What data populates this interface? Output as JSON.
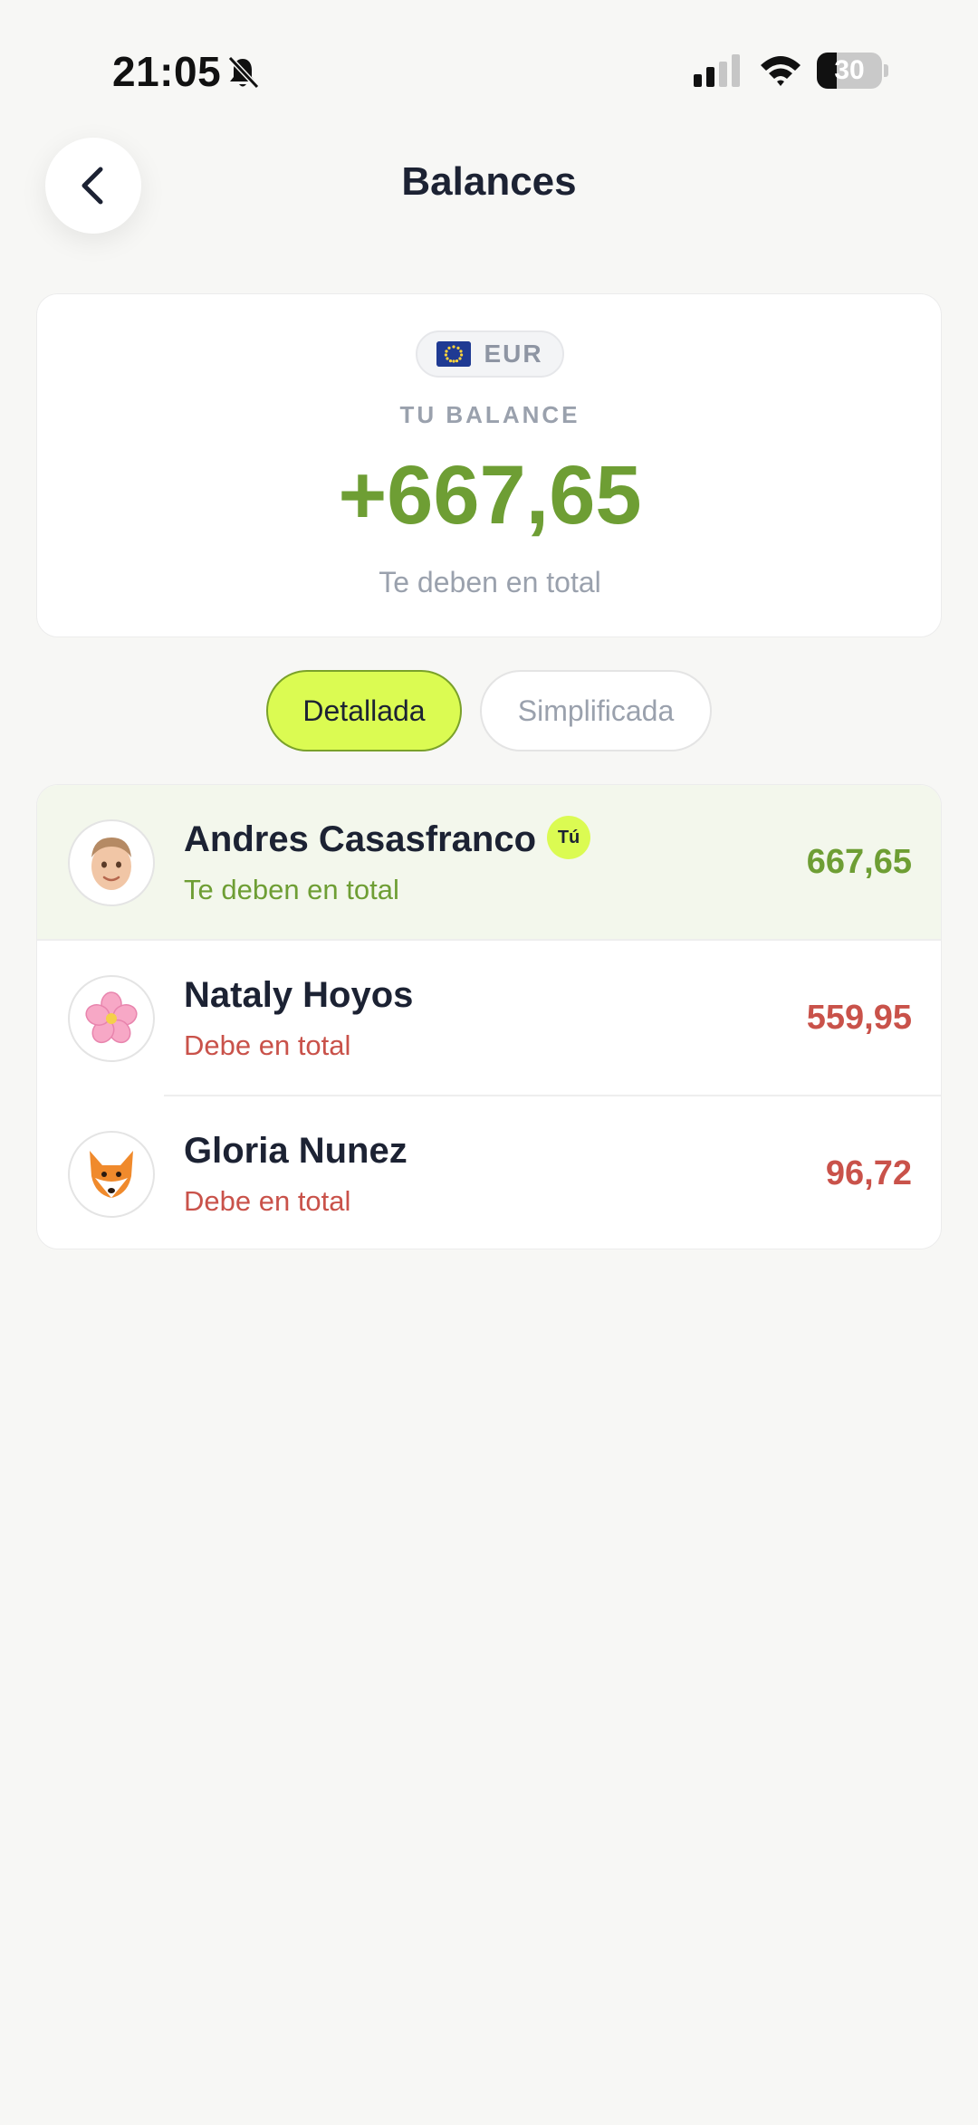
{
  "status_bar": {
    "time": "21:05",
    "battery_level": "30",
    "icons": [
      "bell-slash-icon",
      "cellular-signal-icon",
      "wifi-icon",
      "battery-icon"
    ]
  },
  "header": {
    "title": "Balances",
    "back_icon": "chevron-left-icon"
  },
  "balance_card": {
    "currency_flag": "eu-flag-icon",
    "currency_code": "EUR",
    "label": "TU BALANCE",
    "amount": "+667,65",
    "caption": "Te deben en total"
  },
  "view_toggle": {
    "options": [
      {
        "label": "Detallada",
        "selected": true
      },
      {
        "label": "Simplificada",
        "selected": false
      }
    ]
  },
  "members": [
    {
      "name": "Andres Casasfranco",
      "badge": "Tú",
      "status": "Te deben en total",
      "amount": "667,65",
      "avatar": "memoji-face-icon"
    },
    {
      "name": "Nataly Hoyos",
      "status": "Debe en total",
      "amount": "559,95",
      "avatar": "cherry-blossom-icon"
    },
    {
      "name": "Gloria Nunez",
      "status": "Debe en total",
      "amount": "96,72",
      "avatar": "fox-face-icon"
    }
  ],
  "colors": {
    "positive": "#6e9e34",
    "negative": "#c9524a",
    "accent": "#dbfb52",
    "background": "#f7f7f5"
  }
}
